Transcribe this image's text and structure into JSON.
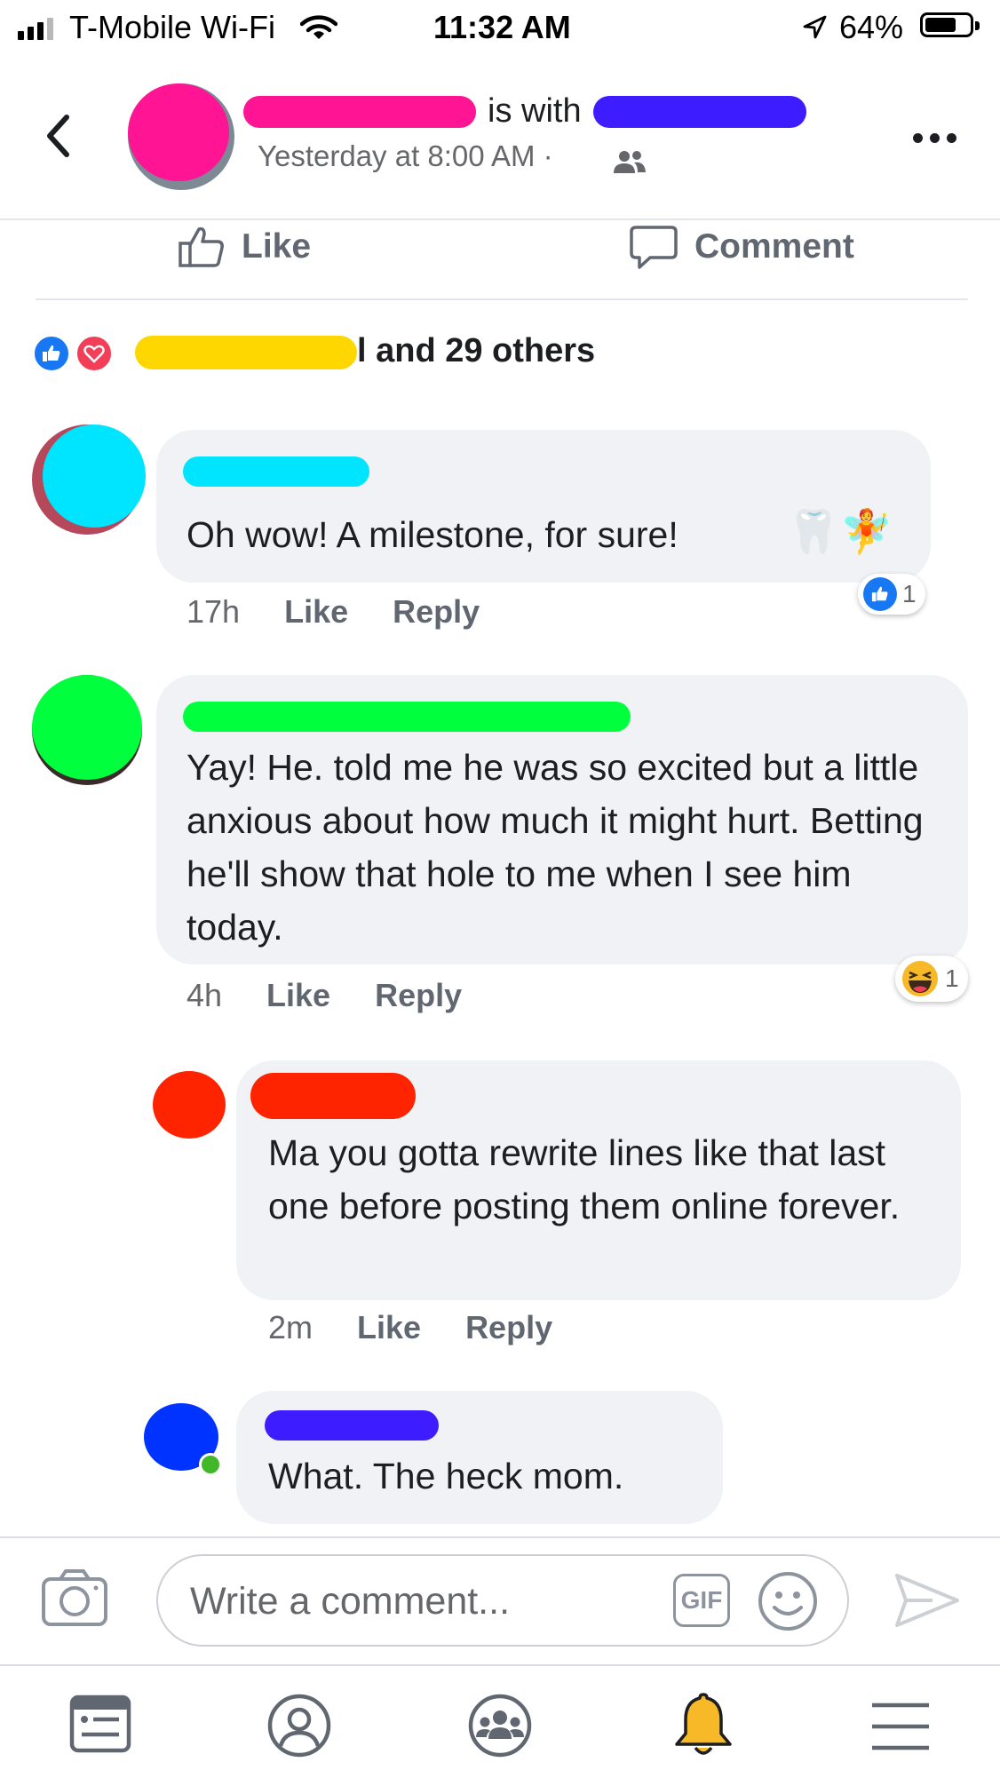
{
  "status_bar": {
    "carrier": "T-Mobile Wi-Fi",
    "time": "11:32 AM",
    "battery": "64%",
    "battery_level": 0.64
  },
  "header": {
    "title_suffix": "is with",
    "subtitle": "Yesterday at 8:00 AM ·",
    "privacy_icon": "friends-icon",
    "more_icon": "more-dots-icon"
  },
  "actions": {
    "like_label": "Like",
    "comment_label": "Comment"
  },
  "reactions": {
    "summary": "l and 29 others",
    "icons": [
      "like-icon",
      "love-icon"
    ]
  },
  "comments": [
    {
      "text": "Oh wow! A milestone, for sure!",
      "emojis": "🦷🧚",
      "time": "17h",
      "like": "Like",
      "reply": "Reply",
      "reaction_count": "1",
      "reaction_icon": "like-icon"
    },
    {
      "text": "Yay! He. told me he was so excited but a little anxious about how much it might hurt. Betting he'll show that hole to me when I see him today.",
      "time": "4h",
      "like": "Like",
      "reply": "Reply",
      "reaction_count": "1",
      "reaction_icon": "haha-icon"
    },
    {
      "text": "Ma you gotta rewrite lines like that last one before posting them online forever.",
      "time": "2m",
      "like": "Like",
      "reply": "Reply"
    },
    {
      "text": "What. The heck mom."
    }
  ],
  "composer": {
    "placeholder": "Write a comment...",
    "gif_label": "GIF"
  },
  "tabbar": [
    "news-feed-icon",
    "profile-icon",
    "groups-icon",
    "notifications-icon",
    "menu-icon"
  ],
  "colors": {
    "accent": "#1877f2",
    "bubble": "#f0f2f5",
    "love": "#f33e58",
    "bell": "#f7b928"
  }
}
